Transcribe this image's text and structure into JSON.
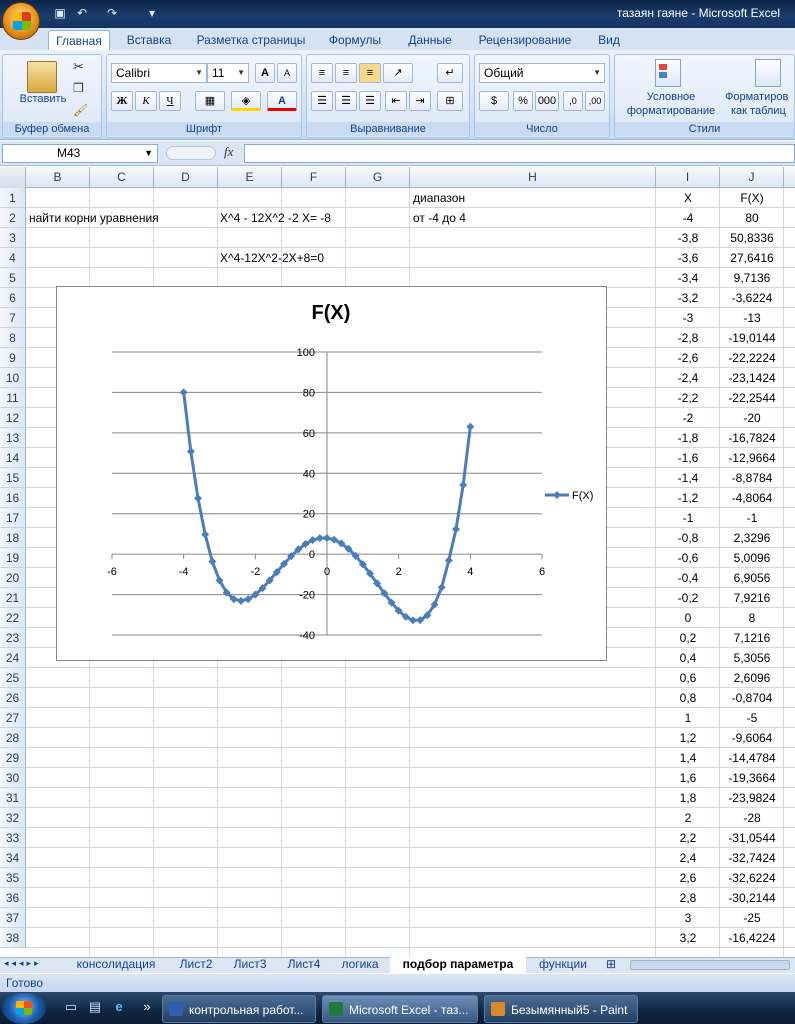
{
  "window": {
    "title": "тазаян гаяне - Microsoft Excel"
  },
  "ribbon": {
    "tabs": [
      "Главная",
      "Вставка",
      "Разметка страницы",
      "Формулы",
      "Данные",
      "Рецензирование",
      "Вид"
    ],
    "groups": {
      "clipboard": {
        "label": "Буфер обмена",
        "paste": "Вставить"
      },
      "font": {
        "label": "Шрифт",
        "font_name": "Calibri",
        "font_size": "11",
        "bold": "Ж",
        "italic": "К",
        "underline": "Ч"
      },
      "alignment": {
        "label": "Выравнивание"
      },
      "number": {
        "label": "Число",
        "format": "Общий",
        "percent": "%",
        "thousands": "000"
      },
      "styles": {
        "label": "Стили",
        "conditional_l1": "Условное",
        "conditional_l2": "форматирование",
        "table_l1": "Форматиров",
        "table_l2": "как таблиц"
      }
    }
  },
  "formula_bar": {
    "name_box": "M43",
    "fx": "fx",
    "formula": ""
  },
  "columns": [
    "B",
    "C",
    "D",
    "E",
    "F",
    "G",
    "H",
    "I",
    "J"
  ],
  "rows": [
    "1",
    "2",
    "3",
    "4",
    "5",
    "6",
    "7",
    "8",
    "9",
    "10",
    "11",
    "12",
    "13",
    "14",
    "15",
    "16",
    "17",
    "18",
    "19",
    "20",
    "21",
    "22",
    "23",
    "24",
    "25",
    "26",
    "27",
    "28",
    "29",
    "30",
    "31",
    "32",
    "33",
    "34",
    "35",
    "36",
    "37",
    "38"
  ],
  "cells": {
    "B2": "найти корни уравнения",
    "E2": "X^4 - 12X^2 -2 X= -8",
    "E4": "X^4-12X^2-2X+8=0",
    "H1": "диапазон",
    "H2": "от -4 до 4",
    "I1": "X",
    "J1": "F(X)"
  },
  "table": {
    "x": [
      "-4",
      "-3,8",
      "-3,6",
      "-3,4",
      "-3,2",
      "-3",
      "-2,8",
      "-2,6",
      "-2,4",
      "-2,2",
      "-2",
      "-1,8",
      "-1,6",
      "-1,4",
      "-1,2",
      "-1",
      "-0,8",
      "-0,6",
      "-0,4",
      "-0,2",
      "0",
      "0,2",
      "0,4",
      "0,6",
      "0,8",
      "1",
      "1,2",
      "1,4",
      "1,6",
      "1,8",
      "2",
      "2,2",
      "2,4",
      "2,6",
      "2,8",
      "3",
      "3,2"
    ],
    "fx": [
      "80",
      "50,8336",
      "27,6416",
      "9,7136",
      "-3,6224",
      "-13",
      "-19,0144",
      "-22,2224",
      "-23,1424",
      "-22,2544",
      "-20",
      "-16,7824",
      "-12,9664",
      "-8,8784",
      "-4,8064",
      "-1",
      "2,3296",
      "5,0096",
      "6,9056",
      "7,9216",
      "8",
      "7,1216",
      "5,3056",
      "2,6096",
      "-0,8704",
      "-5",
      "-9,6064",
      "-14,4784",
      "-19,3664",
      "-23,9824",
      "-28",
      "-31,0544",
      "-32,7424",
      "-32,6224",
      "-30,2144",
      "-25",
      "-16,4224"
    ]
  },
  "chart_data": {
    "type": "scatter",
    "title": "F(X)",
    "xlabel": "",
    "ylabel": "",
    "xlim": [
      -6,
      6
    ],
    "ylim": [
      -40,
      100
    ],
    "xticks": [
      "-6",
      "-4",
      "-2",
      "0",
      "2",
      "4",
      "6"
    ],
    "yticks": [
      "-40",
      "-20",
      "0",
      "20",
      "40",
      "60",
      "80",
      "100"
    ],
    "grid": true,
    "legend": "right",
    "series": [
      {
        "name": "F(X)",
        "color": "#4a7ebb",
        "x": [
          -4,
          -3.8,
          -3.6,
          -3.4,
          -3.2,
          -3,
          -2.8,
          -2.6,
          -2.4,
          -2.2,
          -2,
          -1.8,
          -1.6,
          -1.4,
          -1.2,
          -1,
          -0.8,
          -0.6,
          -0.4,
          -0.2,
          0,
          0.2,
          0.4,
          0.6,
          0.8,
          1,
          1.2,
          1.4,
          1.6,
          1.8,
          2,
          2.2,
          2.4,
          2.6,
          2.8,
          3,
          3.2,
          3.4,
          3.6,
          3.8,
          4
        ],
        "y": [
          80,
          50.8336,
          27.6416,
          9.7136,
          -3.6224,
          -13,
          -19.0144,
          -22.2224,
          -23.1424,
          -22.2544,
          -20,
          -16.7824,
          -12.9664,
          -8.8784,
          -4.8064,
          -1,
          2.3296,
          5.0096,
          6.9056,
          7.9216,
          8,
          7.1216,
          5.3056,
          2.6096,
          -0.8704,
          -5,
          -9.6064,
          -14.4784,
          -19.3664,
          -23.9824,
          -28,
          -31.0544,
          -32.7424,
          -32.6224,
          -30.2144,
          -25,
          -16.4224,
          -3.0864,
          12.3456,
          34.2784,
          63
        ]
      }
    ]
  },
  "sheet_tabs": [
    "консолидация",
    "Лист2",
    "Лист3",
    "Лист4",
    "логика",
    "подбор параметра",
    "функции"
  ],
  "active_sheet": "подбор параметра",
  "status": {
    "text": "Готово"
  },
  "taskbar": {
    "items": [
      "контрольная работ...",
      "Microsoft Excel - таз...",
      "Безымянный5 - Paint"
    ]
  }
}
